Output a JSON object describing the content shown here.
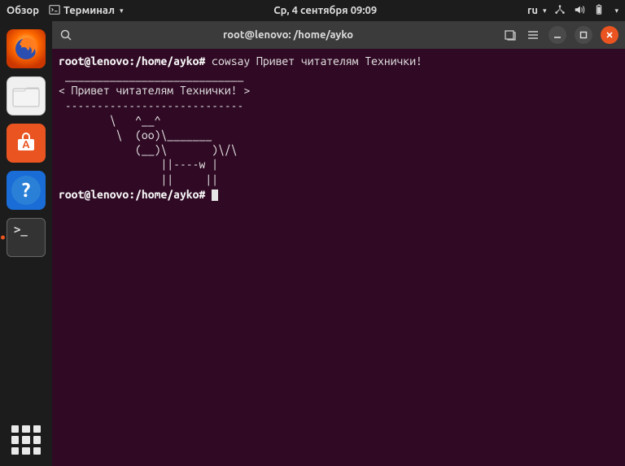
{
  "top_panel": {
    "activities": "Обзор",
    "app_menu": "Терминал",
    "datetime": "Ср, 4 сентября  09:09",
    "lang": "ru"
  },
  "window": {
    "title": "root@lenovo: /home/ayko"
  },
  "terminal": {
    "prompt": "root@lenovo:/home/ayko#",
    "command": "cowsay Привет читателям Технички!",
    "output": " ____________________________\n< Привет читателям Технички! >\n ----------------------------\n        \\   ^__^\n         \\  (oo)\\_______\n            (__)\\       )\\/\\\n                ||----w |\n                ||     ||"
  },
  "dock": {
    "terminal_glyph": ">_"
  }
}
